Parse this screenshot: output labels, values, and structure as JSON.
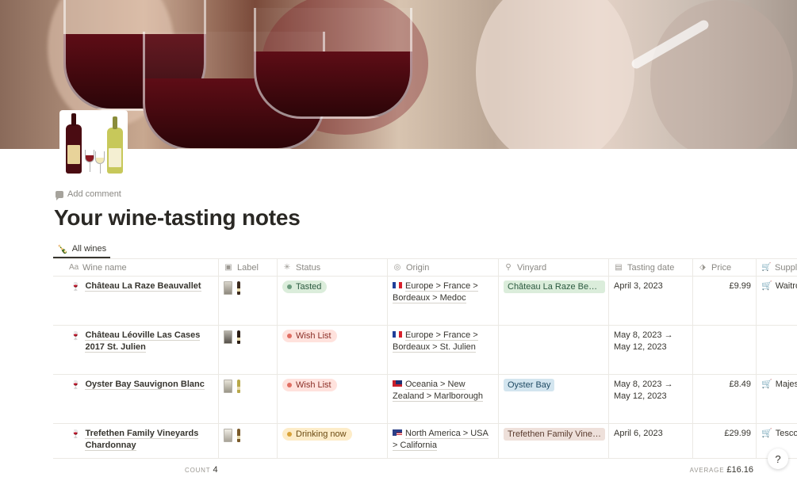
{
  "page": {
    "add_comment": "Add comment",
    "title": "Your wine-tasting notes",
    "view_tab": "All wines"
  },
  "columns": [
    {
      "label": "Wine name",
      "icon": "text-icon"
    },
    {
      "label": "Label",
      "icon": "image-icon"
    },
    {
      "label": "Status",
      "icon": "status-icon"
    },
    {
      "label": "Origin",
      "icon": "globe-icon"
    },
    {
      "label": "Vinyard",
      "icon": "pin-icon"
    },
    {
      "label": "Tasting date",
      "icon": "calendar-icon"
    },
    {
      "label": "Price",
      "icon": "tag-icon"
    },
    {
      "label": "Suppli",
      "icon": "cart-icon"
    }
  ],
  "rows": [
    {
      "name": "Château La Raze Beauvallet",
      "status": "Tasted",
      "status_color": "#dbeddb",
      "status_dot": "#6c9b7d",
      "origin": "Europe > France > Bordeaux > Medoc",
      "flag": "fr",
      "vinyard": "Château La Raze Beauva...",
      "vinyard_bg": "#dbeddb",
      "tasting_date": "April 3, 2023",
      "price": "£9.99",
      "supplier": "Waitro"
    },
    {
      "name": "Château Léoville Las Cases 2017 St. Julien",
      "status": "Wish List",
      "status_color": "#ffe2dd",
      "status_dot": "#e16f64",
      "origin": "Europe > France > Bordeaux > St. Julien",
      "flag": "fr",
      "vinyard": "",
      "vinyard_bg": "",
      "tasting_date": "May 8, 2023 → May 12, 2023",
      "price": "",
      "supplier": ""
    },
    {
      "name": "Oyster Bay Sauvignon Blanc",
      "status": "Wish List",
      "status_color": "#ffe2dd",
      "status_dot": "#e16f64",
      "origin": "Oceania > New Zealand > Marlborough",
      "flag": "nz",
      "vinyard": "Oyster Bay",
      "vinyard_bg": "#d3e5ef",
      "tasting_date": "May 8, 2023 → May 12, 2023",
      "price": "£8.49",
      "supplier": "Majes"
    },
    {
      "name": "Trefethen Family Vineyards Chardonnay",
      "status": "Drinking now",
      "status_color": "#fdecc8",
      "status_dot": "#d9a33a",
      "origin": "North America > USA > California",
      "flag": "us",
      "vinyard": "Trefethen Family Vineyar...",
      "vinyard_bg": "#eee0da",
      "tasting_date": "April 6, 2023",
      "price": "£29.99",
      "supplier": "Tesco"
    }
  ],
  "footer": {
    "count_label": "COUNT",
    "count_value": "4",
    "avg_label": "AVERAGE",
    "avg_value": "£16.16"
  },
  "help": "?"
}
